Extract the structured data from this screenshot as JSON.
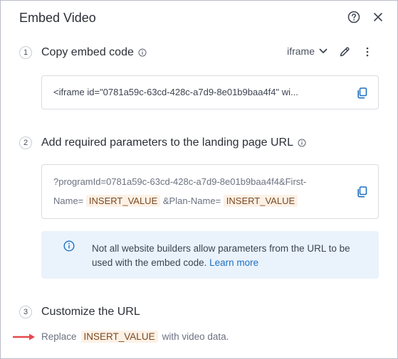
{
  "dialog": {
    "title": "Embed Video"
  },
  "steps": [
    {
      "num": "1",
      "title": "Copy embed code",
      "format": "iframe"
    },
    {
      "num": "2",
      "title": "Add required parameters to the landing page URL"
    },
    {
      "num": "3",
      "title": "Customize the URL"
    }
  ],
  "embed": {
    "code": "<iframe id=\"0781a59c-63cd-428c-a7d9-8e01b9baa4f4\" wi..."
  },
  "params": {
    "line1": "?programId=0781a59c-63cd-428c-a7d9-8e01b9baa4f4&First-",
    "prefix": "Name=",
    "token1": "INSERT_VALUE",
    "middle": "&Plan-Name=",
    "token2": "INSERT_VALUE"
  },
  "note": {
    "text": "Not all website builders allow parameters from the URL to be used with the embed code.",
    "link": "Learn more"
  },
  "customize": {
    "before": "Replace",
    "token": "INSERT_VALUE",
    "after": "with video data."
  },
  "colors": {
    "accent": "#1d6fc2",
    "note_bg": "#eaf3fb",
    "highlight_bg": "#fdf1e6",
    "arrow": "#e5484d"
  },
  "icons": [
    "help-icon",
    "close-icon",
    "info-icon",
    "chevron-down-icon",
    "pencil-icon",
    "more-vertical-icon",
    "copy-icon",
    "info-circle-icon",
    "arrow-right-icon"
  ]
}
